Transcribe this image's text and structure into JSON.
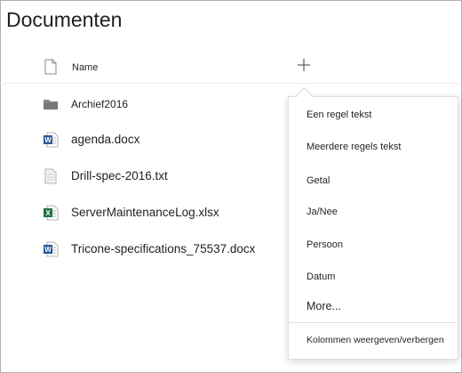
{
  "page": {
    "title": "Documenten"
  },
  "list_header": {
    "name_label": "Name",
    "add_column_icon": "plus-icon"
  },
  "files": [
    {
      "name": "Archief2016",
      "icon": "folder-icon"
    },
    {
      "name": "agenda.docx",
      "icon": "word-icon"
    },
    {
      "name": "Drill-spec-2016.txt",
      "icon": "text-file-icon"
    },
    {
      "name": "ServerMaintenanceLog.xlsx",
      "icon": "excel-icon"
    },
    {
      "name": "Tricone-specifications_75537.docx",
      "icon": "word-icon"
    }
  ],
  "menu": {
    "items": [
      "Een regel tekst",
      "Meerdere regels tekst",
      "Getal",
      "Ja/Nee",
      "Persoon",
      "Datum"
    ],
    "more": "More...",
    "footer": "Kolommen weergeven/verbergen"
  },
  "colors": {
    "word": "#2b579a",
    "excel": "#217346",
    "folder": "#8a8886",
    "border": "#b3b0ad"
  }
}
